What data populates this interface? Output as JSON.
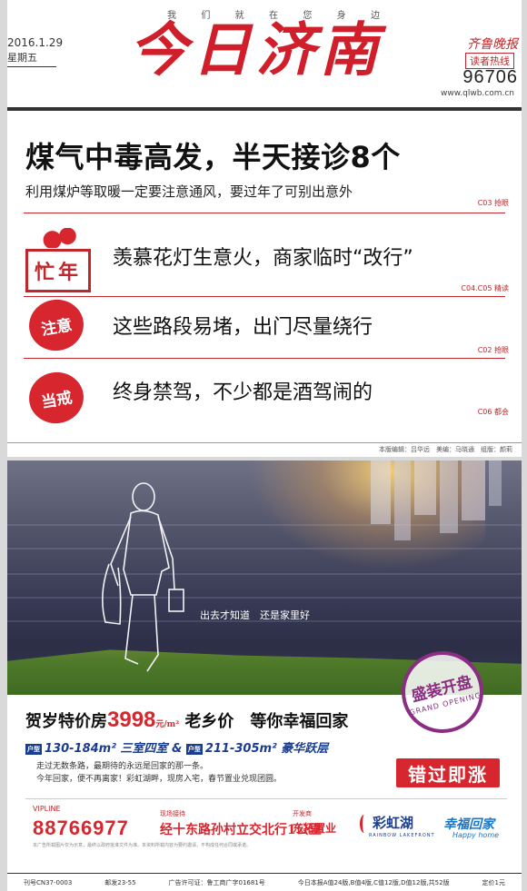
{
  "masthead": {
    "slogan": [
      "我",
      "们",
      "就",
      "在",
      "您",
      "身",
      "边"
    ],
    "date": "2016.1.29",
    "weekday": "星期五",
    "title": "今日济南",
    "brand": "齐鲁晚报",
    "hotline_label": "读者热线",
    "hotline_number": "96706",
    "url": "www.qlwb.com.cn"
  },
  "lead": {
    "title": "煤气中毒高发，半天接诊8个",
    "subtitle": "利用煤炉等取暖一定要注意通风，要过年了可别出意外",
    "ref": "C03 抢眼"
  },
  "items": [
    {
      "badge": "忙年",
      "title": "羡慕花灯生意火，商家临时“改行”",
      "ref": "C04.C05 精读"
    },
    {
      "badge": "注意",
      "title": "这些路段易堵，出门尽量绕行",
      "ref": "C02 抢眼"
    },
    {
      "badge": "当戒",
      "title": "终身禁驾，不少都是酒驾闹的",
      "ref": "C06 都会"
    }
  ],
  "editors": "本版编辑：吕华远　美编：马晓通　组版：颜莉",
  "ad": {
    "caption": "出去才知道　还是家里好",
    "stamp_main": "盛装开盘",
    "stamp_sub": "GRAND OPENING",
    "headline_pre": "贺岁特价房",
    "price": "3998",
    "price_unit": "元/m²",
    "headline_post": "老乡价　等你幸福回家",
    "unit_tag": "户型",
    "units_a": "130-184m² 三室四室",
    "units_amp": "&",
    "units_b": "211-305m² 豪华跃层",
    "body": [
      "走过无数条路，最期待的永远是回家的那一条。",
      "今年回家，便不再离家！彩虹湖畔，现房入宅，春节置业兑现团圆。"
    ],
    "cta": "错过即涨",
    "vip_label": "VIPLINE",
    "vip_number": "88766977",
    "addr_label": "现场接待",
    "addr": "经十东路孙村立交北行1公里",
    "dev_label": "开发商",
    "dev": "东拓置业",
    "logo1": "彩虹湖",
    "logo1_sub": "RAINBOW LAKEFRONT",
    "logo2": "幸福回家",
    "logo2_sub": "Happy home",
    "fine": "本广告所载图片仅为示意，最终以政府批准文件为准。本资料所载内容为要约邀请，不构成任何合同或承诺。"
  },
  "footer": [
    "刊号CN37-0003",
    "邮发23-55",
    "广告许可证：鲁工商广字01681号",
    "今日本报A值24版,B值4版,C值12版,D值12版,共52版",
    "定价1元"
  ]
}
